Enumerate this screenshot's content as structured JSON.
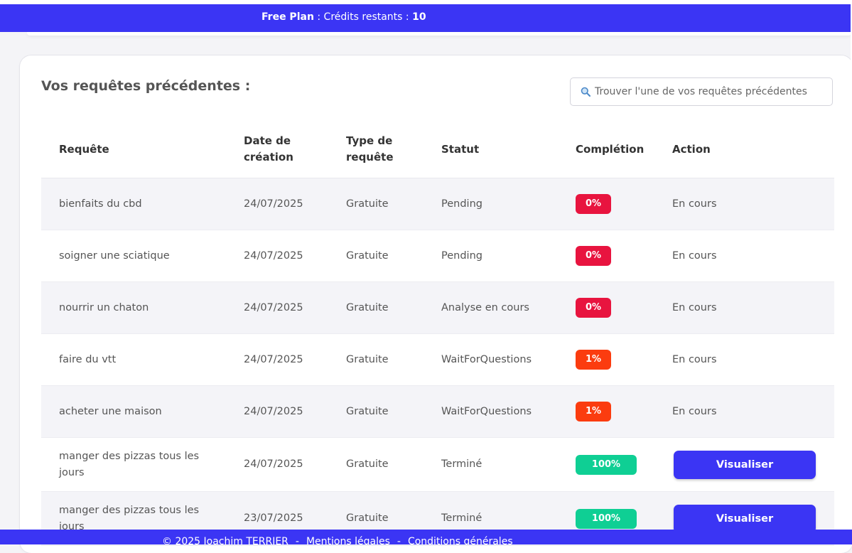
{
  "banner": {
    "plan_label": "Free Plan",
    "credits_label": " : Crédits restants : ",
    "credits_value": "10"
  },
  "history": {
    "title": "Vos requêtes précédentes :",
    "search_placeholder": "Trouver l'une de vos requêtes précédentes",
    "columns": {
      "request": "Requête",
      "created": "Date de création",
      "type": "Type de requête",
      "status": "Statut",
      "completion": "Complétion",
      "action": "Action"
    },
    "rows": [
      {
        "request": "bienfaits du cbd",
        "date": "24/07/2025",
        "type": "Gratuite",
        "status": "Pending",
        "completion": "0%",
        "action": "En cours"
      },
      {
        "request": "soigner une sciatique",
        "date": "24/07/2025",
        "type": "Gratuite",
        "status": "Pending",
        "completion": "0%",
        "action": "En cours"
      },
      {
        "request": "nourrir un chaton",
        "date": "24/07/2025",
        "type": "Gratuite",
        "status": "Analyse en cours",
        "completion": "0%",
        "action": "En cours"
      },
      {
        "request": "faire du vtt",
        "date": "24/07/2025",
        "type": "Gratuite",
        "status": "WaitForQuestions",
        "completion": "1%",
        "action": "En cours"
      },
      {
        "request": "acheter une maison",
        "date": "24/07/2025",
        "type": "Gratuite",
        "status": "WaitForQuestions",
        "completion": "1%",
        "action": "En cours"
      },
      {
        "request": "manger des pizzas tous les jours",
        "date": "24/07/2025",
        "type": "Gratuite",
        "status": "Terminé",
        "completion": "100%",
        "action": "Visualiser"
      },
      {
        "request": "manger des pizzas tous les jours",
        "date": "23/07/2025",
        "type": "Gratuite",
        "status": "Terminé",
        "completion": "100%",
        "action": "Visualiser"
      }
    ]
  },
  "footer": {
    "copyright": "© 2025 Joachim TERRIER",
    "separator": "-",
    "legal": "Mentions légales",
    "terms": "Conditions générales"
  },
  "colors": {
    "primary": "#3b35f4",
    "badge_red": "#e8143f",
    "badge_orange": "#fb3c0f",
    "badge_green": "#0fcf94"
  }
}
